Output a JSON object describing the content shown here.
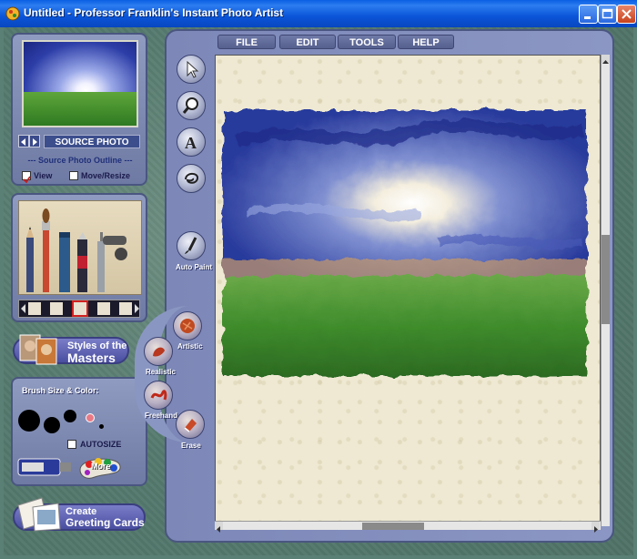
{
  "window": {
    "title": "Untitled - Professor Franklin's Instant Photo Artist"
  },
  "source": {
    "label": "SOURCE PHOTO",
    "outline_title": "--- Source Photo Outline ---",
    "view_label": "View",
    "view_checked": true,
    "move_label": "Move/Resize",
    "move_checked": false
  },
  "masters": {
    "line1": "Styles of the",
    "line2": "Masters"
  },
  "brush": {
    "title": "Brush Size & Color:",
    "autosize_label": "AUTOSIZE",
    "more_label": "More"
  },
  "greeting": {
    "line1": "Create",
    "line2": "Greeting Cards"
  },
  "menu": {
    "file": "FILE",
    "edit": "EDIT",
    "tools": "TOOLS",
    "help": "HELP"
  },
  "tools": {
    "auto_paint": "Auto Paint",
    "artistic": "Artistic",
    "realistic": "Realistic",
    "freehand": "Freehand",
    "erase": "Erase"
  },
  "colors": {
    "titlebar": "#0a55d8",
    "panel": "#7d88b8",
    "paper": "#efe9d3",
    "selected_color": "#e87a86"
  }
}
